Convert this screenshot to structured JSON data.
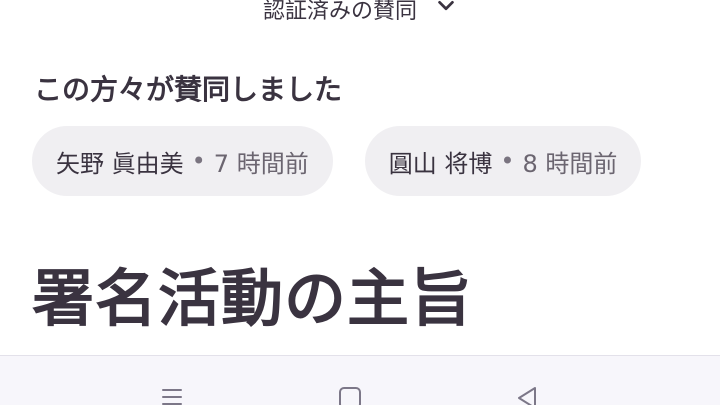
{
  "verified_toggle": {
    "label": "認証済みの賛同",
    "icon": "chevron-down-icon"
  },
  "supporters": {
    "heading": "この方々が賛同しました",
    "items": [
      {
        "name": "矢野 眞由美",
        "separator": "•",
        "time": "7 時間前"
      },
      {
        "name": "圓山 将博",
        "separator": "•",
        "time": "8 時間前"
      }
    ]
  },
  "petition": {
    "title": "署名活動の主旨"
  },
  "system_nav": {
    "buttons": [
      {
        "icon": "menu-icon"
      },
      {
        "icon": "home-square-icon"
      },
      {
        "icon": "back-triangle-icon"
      }
    ]
  },
  "colors": {
    "text": "#3a3340",
    "chip_bg": "#f0eff2",
    "nav_bg": "#f7f6fb"
  }
}
